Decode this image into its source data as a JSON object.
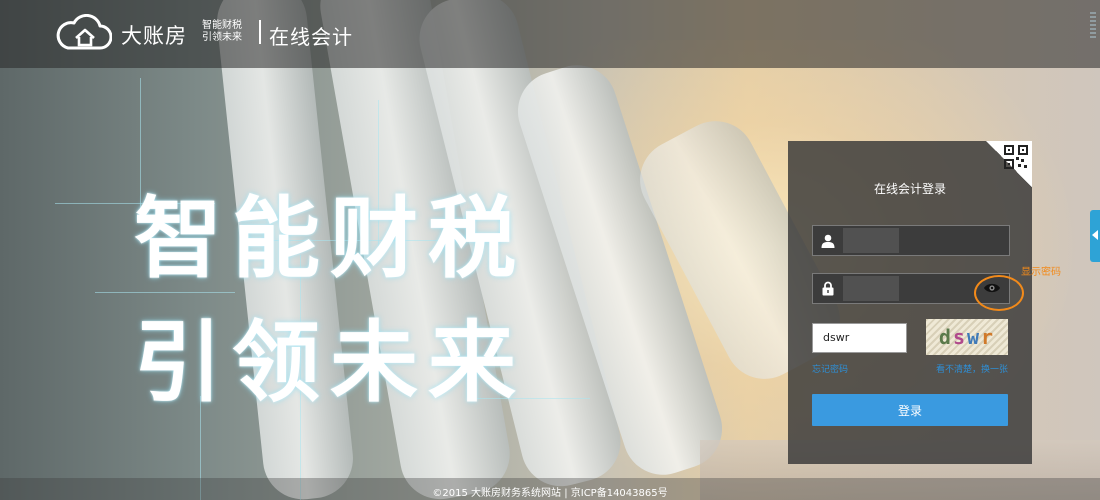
{
  "header": {
    "brand_name": "大账房",
    "slogan_line1": "智能财税",
    "slogan_line2": "引领未来",
    "product_name": "在线会计"
  },
  "hero": {
    "line1": "智能财税",
    "line2": "引领未来"
  },
  "login": {
    "title": "在线会计登录",
    "captcha_value": "dswr",
    "captcha_image_text": "dswr",
    "forgot_password": "忘记密码",
    "refresh_captcha": "看不清楚，换一张",
    "submit_label": "登录"
  },
  "annotation": {
    "label": "显示密码",
    "color": "#f28a1a"
  },
  "footer": {
    "text": "©2015 大账房财务系统网站 | 京ICP备14043865号"
  },
  "colors": {
    "accent": "#3a9ae0",
    "link": "#2e8fd6",
    "panel": "#373737"
  },
  "icons": [
    "cloud-house-icon",
    "qr-code-icon",
    "user-icon",
    "lock-icon",
    "eye-icon",
    "chevron-left-icon"
  ]
}
